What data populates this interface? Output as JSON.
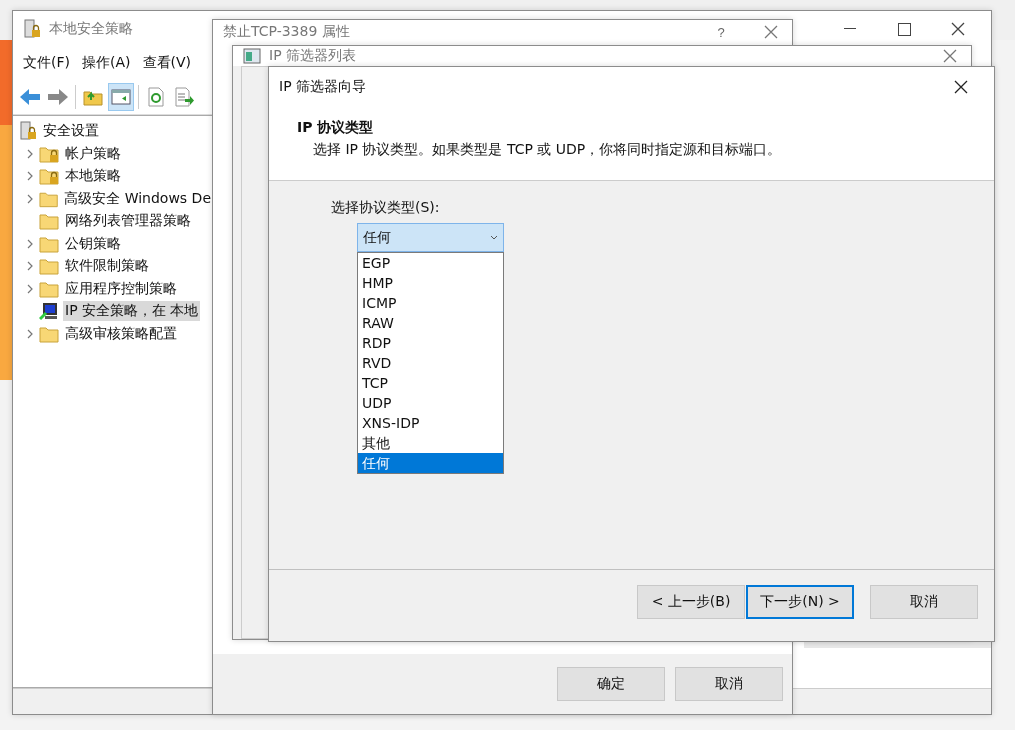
{
  "main_window": {
    "title": "本地安全策略",
    "menu": [
      "文件(F)",
      "操作(A)",
      "查看(V)"
    ],
    "toolbar": [
      {
        "kind": "back",
        "selected": false
      },
      {
        "kind": "forward",
        "selected": false
      },
      {
        "kind": "up",
        "selected": false
      },
      {
        "kind": "tree",
        "selected": true
      },
      {
        "kind": "refresh",
        "selected": false
      },
      {
        "kind": "export",
        "selected": false
      }
    ],
    "tree": {
      "label": "安全设置",
      "kind": "root",
      "children": [
        {
          "label": "帐户策略",
          "kind": "locked",
          "expandable": true,
          "selected": false
        },
        {
          "label": "本地策略",
          "kind": "locked",
          "expandable": true,
          "selected": false
        },
        {
          "label": "高级安全 Windows De",
          "kind": "folder",
          "expandable": true,
          "selected": false
        },
        {
          "label": "网络列表管理器策略",
          "kind": "folder",
          "expandable": false,
          "selected": false
        },
        {
          "label": "公钥策略",
          "kind": "folder",
          "expandable": true,
          "selected": false
        },
        {
          "label": "软件限制策略",
          "kind": "folder",
          "expandable": true,
          "selected": false
        },
        {
          "label": "应用程序控制策略",
          "kind": "folder",
          "expandable": true,
          "selected": false
        },
        {
          "label": "IP 安全策略，在 本地",
          "kind": "ip",
          "expandable": false,
          "selected": true
        },
        {
          "label": "高级审核策略配置",
          "kind": "folder",
          "expandable": true,
          "selected": false
        }
      ]
    }
  },
  "properties_window": {
    "title": "禁止TCP-3389 属性",
    "help": "?",
    "buttons": [
      "确定",
      "取消"
    ]
  },
  "filter_list_window": {
    "title": "IP 筛选器列表"
  },
  "wizard": {
    "title": "IP 筛选器向导",
    "heading": "IP 协议类型",
    "description": "选择 IP 协议类型。如果类型是 TCP 或 UDP，你将同时指定源和目标端口。",
    "protocol_label": "选择协议类型(S):",
    "protocol_select": {
      "value": "任何",
      "options": [
        {
          "label": "EGP",
          "selected": false
        },
        {
          "label": "HMP",
          "selected": false
        },
        {
          "label": "ICMP",
          "selected": false
        },
        {
          "label": "RAW",
          "selected": false
        },
        {
          "label": "RDP",
          "selected": false
        },
        {
          "label": "RVD",
          "selected": false
        },
        {
          "label": "TCP",
          "selected": false
        },
        {
          "label": "UDP",
          "selected": false
        },
        {
          "label": "XNS-IDP",
          "selected": false
        },
        {
          "label": "其他",
          "selected": false
        },
        {
          "label": "任何",
          "selected": true
        }
      ]
    },
    "buttons": [
      {
        "label": "< 上一步(B)",
        "focused": false
      },
      {
        "label": "下一步(N) >",
        "focused": true
      },
      {
        "label": "取消",
        "focused": false
      }
    ]
  }
}
